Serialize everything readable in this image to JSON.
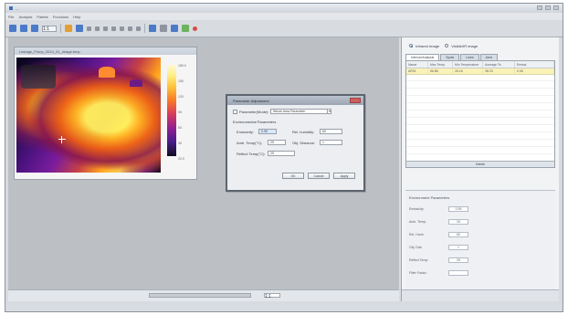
{
  "window": {
    "title": "..."
  },
  "menu": [
    "File",
    "Analysis",
    "Palette",
    "Functions",
    "Help"
  ],
  "toolbar": {
    "zoom_value": "1:1"
  },
  "image_window": {
    "title": "Linkage_Pump_2010_01_Image.bmp",
    "colorbar_labels": [
      "180.0",
      "150",
      "120",
      "90",
      "60",
      "30",
      "22.0"
    ]
  },
  "dialog": {
    "title": "Parameter Adjustment",
    "parameter_label": "Parameter(Mode):",
    "parameter_value": "Whole Area Parameter",
    "section_label": "Environmental Parameters",
    "emissivity_label": "Emissivity:",
    "emissivity_value": "0.95",
    "humidity_label": "Rel. humidity:",
    "humidity_value": "60",
    "ambient_label": "Amb. Temp(°C):",
    "ambient_value": "25",
    "distance_label": "Obj. Distance:",
    "distance_value": "1",
    "reflect_label": "Reflect Temp(°C):",
    "reflect_value": "25",
    "ok": "OK",
    "cancel": "Cancel",
    "apply": "Apply"
  },
  "right_panel": {
    "radio_1": "Infrared Image",
    "radio_2": "Visible/IR image",
    "tabs": [
      "Interval Analysis",
      "Spots",
      "Lines",
      "Area"
    ],
    "table_headers": [
      "Name",
      "Max Temp",
      "Min Temperature",
      "Average Te.",
      "Emissi."
    ],
    "table_row": [
      "AR01",
      "56.86",
      "26.16",
      "38.23",
      "0.95"
    ],
    "table_button": "Delete",
    "params_title": "Environment Parameters",
    "params": [
      {
        "label": "Emissivity:",
        "value": "0.95"
      },
      {
        "label": "Amb. Temp:",
        "value": "25"
      },
      {
        "label": "Rel. Humi:",
        "value": "60"
      },
      {
        "label": "Obj. Dist:",
        "value": "1"
      },
      {
        "label": "Reflect Temp:",
        "value": "25"
      },
      {
        "label": "Filter Factor:",
        "value": ""
      }
    ]
  },
  "bottom": {
    "page_info": "1:1"
  }
}
